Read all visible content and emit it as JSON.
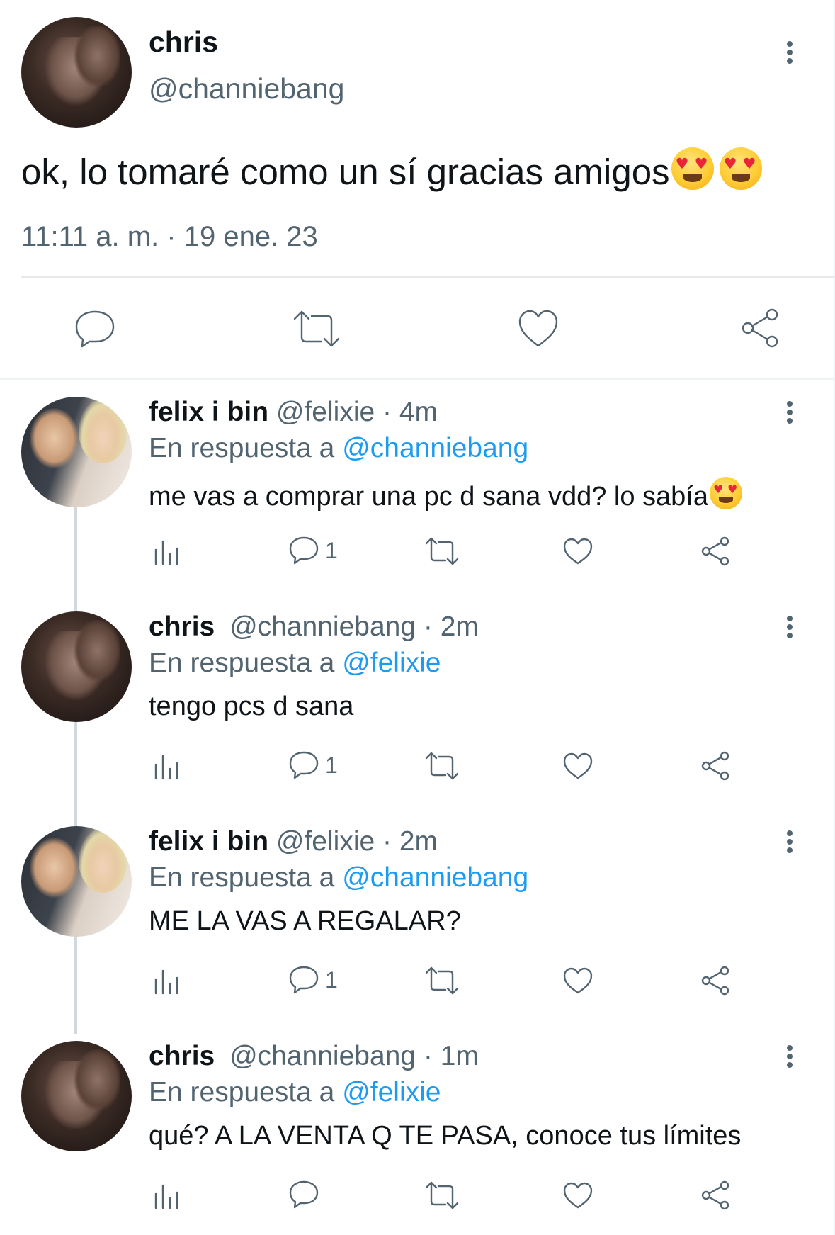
{
  "main_tweet": {
    "author_name": "chris",
    "author_handle": "@channiebang",
    "text": "ok, lo tomaré como un sí gracias amigos",
    "timestamp": "11:11 a. m. · 19 ene. 23",
    "actions": [
      "reply-icon",
      "retweet-icon",
      "like-icon",
      "share-icon"
    ]
  },
  "replies": [
    {
      "author_name": "felix i bin",
      "author_handle": "@felixie",
      "time": "· 4m",
      "reply_prefix": "En respuesta a",
      "reply_to": "@channiebang",
      "text": "me vas a comprar una pc d sana vdd? lo sabía",
      "reply_count": "1"
    },
    {
      "author_name": "chris",
      "author_handle": "@channiebang",
      "time": "· 2m",
      "reply_prefix": "En respuesta a",
      "reply_to": "@felixie",
      "text": "tengo pcs d sana",
      "reply_count": "1"
    },
    {
      "author_name": "felix i bin",
      "author_handle": "@felixie",
      "time": "· 2m",
      "reply_prefix": "En respuesta a",
      "reply_to": "@channiebang",
      "text": "ME LA VAS A REGALAR?",
      "reply_count": "1"
    },
    {
      "author_name": "chris",
      "author_handle": "@channiebang",
      "time": "· 1m",
      "reply_prefix": "En respuesta a",
      "reply_to": "@felixie",
      "text": "qué? A LA VENTA Q TE PASA, conoce tus límites",
      "reply_count": ""
    }
  ],
  "colors": {
    "text": "#0f1419",
    "secondary": "#536471",
    "link": "#1d9bf0",
    "divider": "#e7e9ea"
  }
}
